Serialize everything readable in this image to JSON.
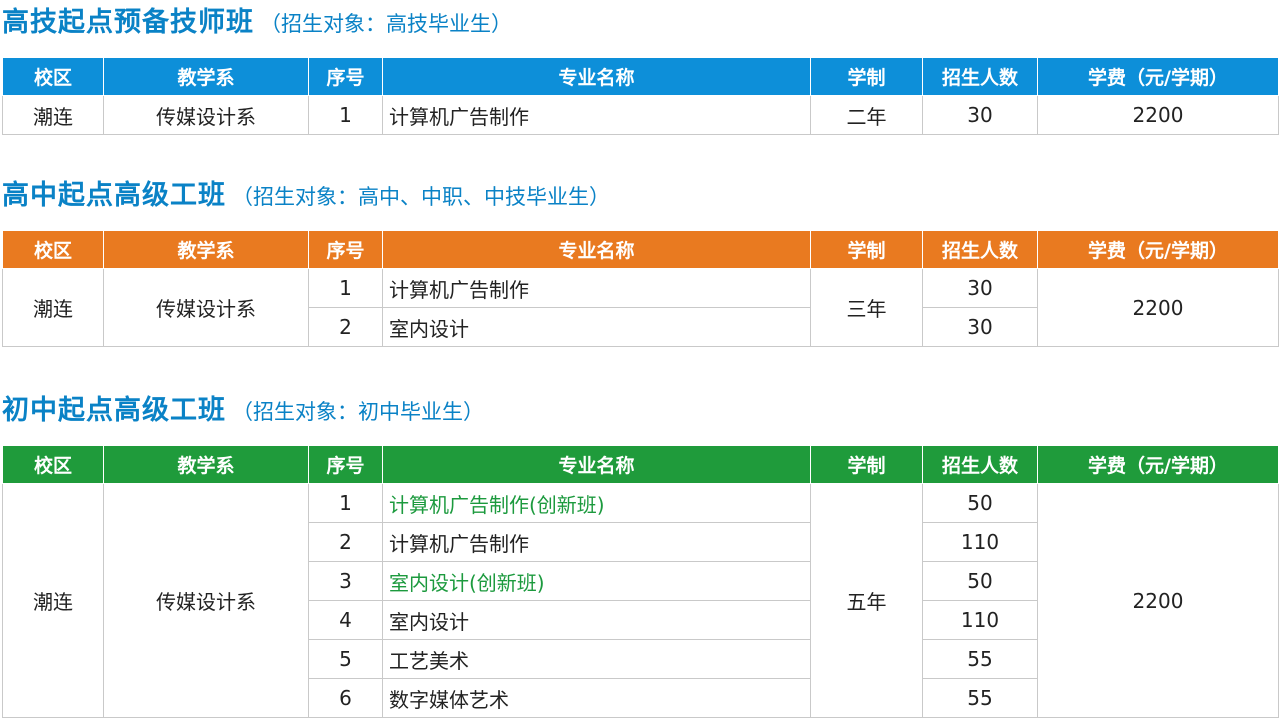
{
  "headers": [
    "校区",
    "教学系",
    "序号",
    "专业名称",
    "学制",
    "招生人数",
    "学费（元/学期）"
  ],
  "sections": [
    {
      "title": "高技起点预备技师班",
      "subtitle": "（招生对象：高技毕业生）",
      "campus": "潮连",
      "department": "传媒设计系",
      "duration": "二年",
      "tuition": "2200",
      "rows": [
        {
          "no": "1",
          "major": "计算机广告制作",
          "enroll": "30"
        }
      ]
    },
    {
      "title": "高中起点高级工班",
      "subtitle": "（招生对象：高中、中职、中技毕业生）",
      "campus": "潮连",
      "department": "传媒设计系",
      "duration": "三年",
      "tuition": "2200",
      "rows": [
        {
          "no": "1",
          "major": "计算机广告制作",
          "enroll": "30"
        },
        {
          "no": "2",
          "major": "室内设计",
          "enroll": "30"
        }
      ]
    },
    {
      "title": "初中起点高级工班",
      "subtitle": "（招生对象：初中毕业生）",
      "campus": "潮连",
      "department": "传媒设计系",
      "duration": "五年",
      "tuition": "2200",
      "rows": [
        {
          "no": "1",
          "major": "计算机广告制作(创新班)",
          "enroll": "50"
        },
        {
          "no": "2",
          "major": "计算机广告制作",
          "enroll": "110"
        },
        {
          "no": "3",
          "major": "室内设计(创新班)",
          "enroll": "50"
        },
        {
          "no": "4",
          "major": "室内设计",
          "enroll": "110"
        },
        {
          "no": "5",
          "major": "工艺美术",
          "enroll": "55"
        },
        {
          "no": "6",
          "major": "数字媒体艺术",
          "enroll": "55"
        }
      ]
    }
  ],
  "colors": {
    "title": "#0a82c6",
    "header_blue": "#0d8fd9",
    "header_orange": "#e97a20",
    "header_green": "#1f9b3b",
    "innovation_text": "#1c9a3e",
    "border": "#c9c9c9"
  }
}
